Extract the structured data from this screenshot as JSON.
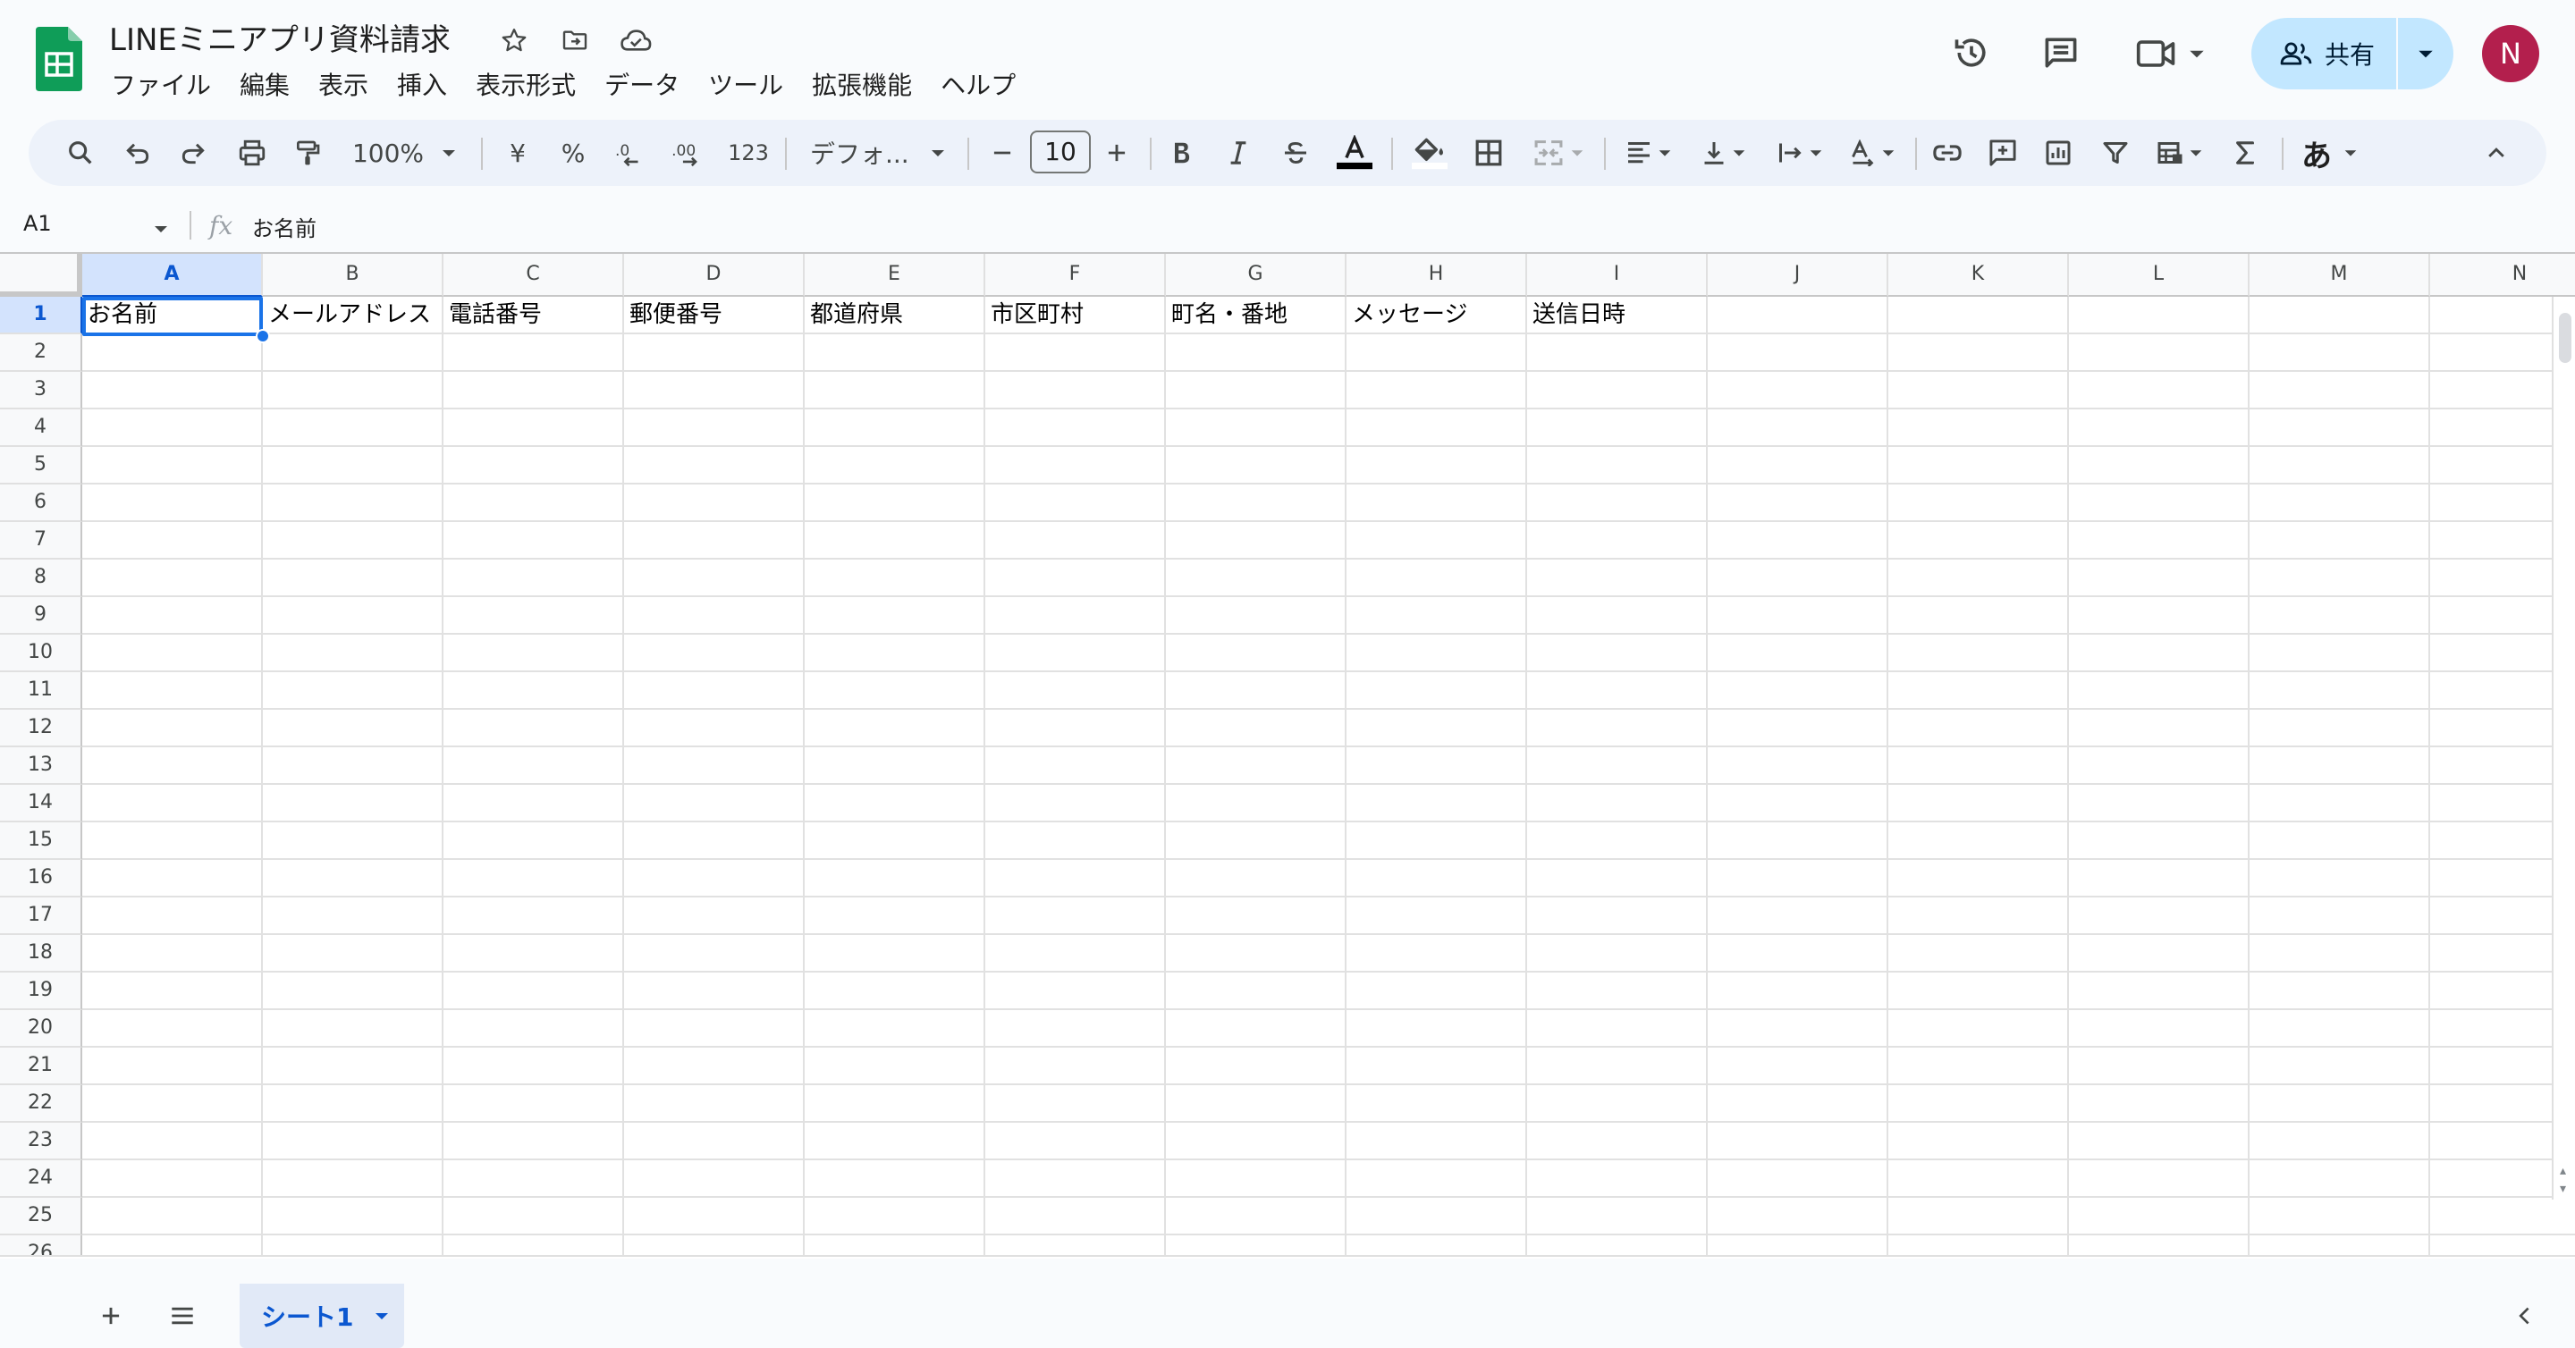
{
  "header": {
    "title": "LINEミニアプリ資料請求",
    "share_label": "共有",
    "avatar_initial": "N"
  },
  "menubar": [
    {
      "label": "ファイル"
    },
    {
      "label": "編集"
    },
    {
      "label": "表示"
    },
    {
      "label": "挿入"
    },
    {
      "label": "表示形式"
    },
    {
      "label": "データ"
    },
    {
      "label": "ツール"
    },
    {
      "label": "拡張機能"
    },
    {
      "label": "ヘルプ"
    }
  ],
  "toolbar": {
    "zoom": "100%",
    "currency": "¥",
    "percent": "%",
    "format_123": "123",
    "font": "デフォ...",
    "font_size": "10",
    "input_mode": "あ"
  },
  "formula_bar": {
    "cell_ref": "A1",
    "fx": "fx",
    "content": "お名前"
  },
  "sheet": {
    "columns": [
      "A",
      "B",
      "C",
      "D",
      "E",
      "F",
      "G",
      "H",
      "I",
      "J",
      "K",
      "L",
      "M",
      "N"
    ],
    "row_count": 26,
    "selected_cell": "A1",
    "header_row": [
      "お名前",
      "メールアドレス",
      "電話番号",
      "郵便番号",
      "都道府県",
      "市区町村",
      "町名・番地",
      "メッセージ",
      "送信日時"
    ]
  },
  "tabs": {
    "active_sheet": "シート1"
  },
  "colors": {
    "accent": "#0b57d0",
    "share_bg": "#c2e7ff",
    "toolbar_bg": "#edf2fa",
    "sheets_green": "#0f9d58",
    "avatar_bg": "#b31f4d"
  }
}
